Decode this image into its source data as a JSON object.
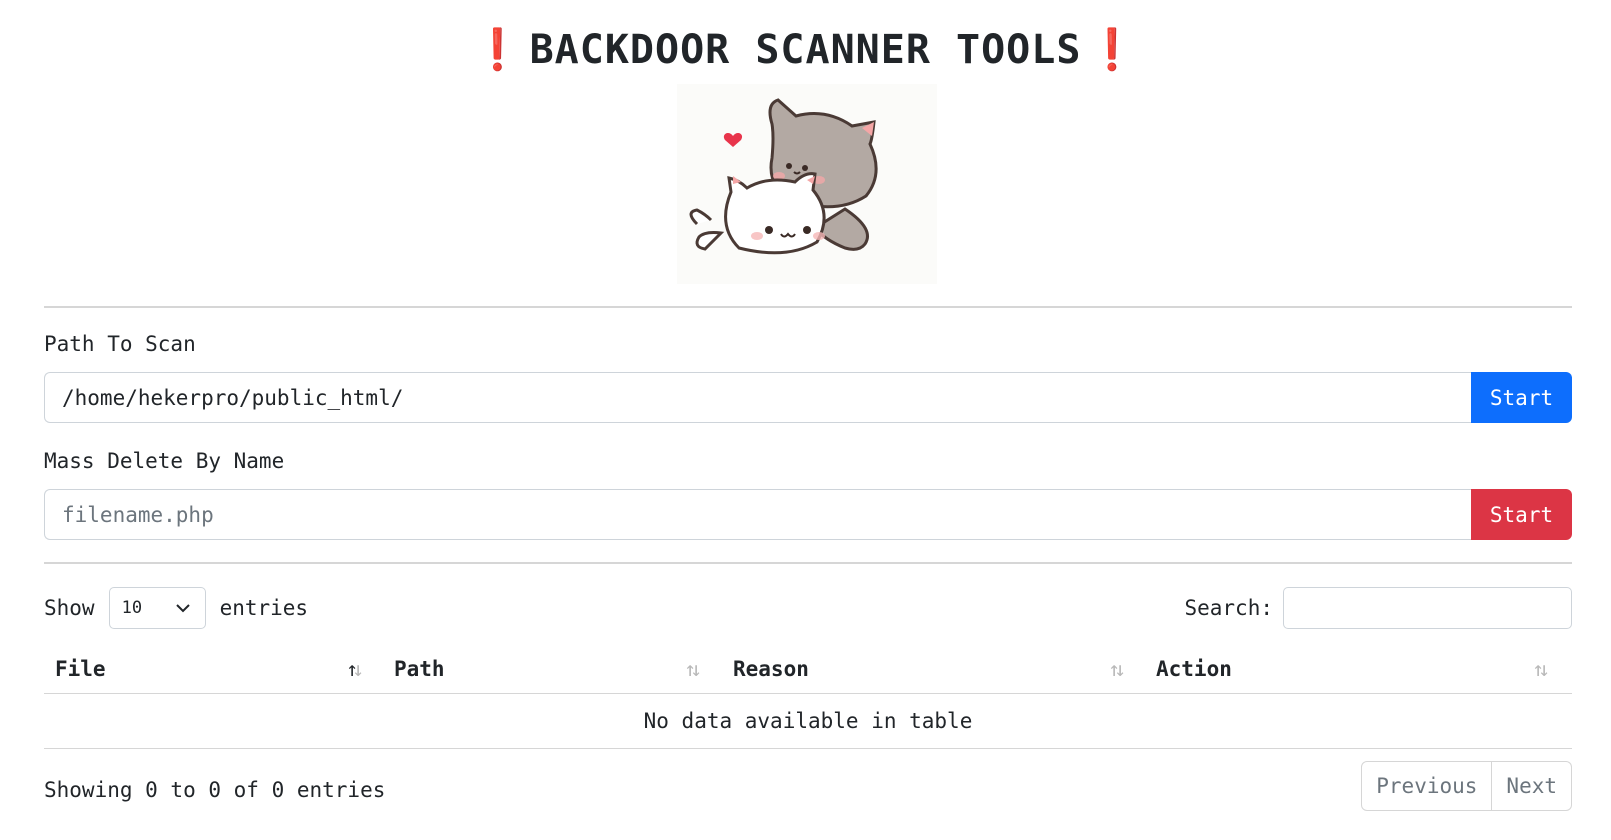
{
  "header": {
    "title": "BACKDOOR SCANNER TOOLS",
    "bang_left": "❗",
    "bang_right": "❗"
  },
  "scan": {
    "label": "Path To Scan",
    "value": "/home/hekerpro/public_html/",
    "button": "Start"
  },
  "mass_delete": {
    "label": "Mass Delete By Name",
    "placeholder": "filename.php",
    "button": "Start"
  },
  "table_controls": {
    "show_label": "Show",
    "entries_value": "10",
    "entries_label": "entries",
    "search_label": "Search:"
  },
  "table": {
    "columns": [
      "File",
      "Path",
      "Reason",
      "Action"
    ],
    "empty_message": "No data available in table"
  },
  "footer": {
    "info": "Showing 0 to 0 of 0 entries",
    "previous": "Previous",
    "next": "Next"
  },
  "colors": {
    "primary": "#0d6efd",
    "danger": "#dc3545",
    "bang": "#e8254b"
  }
}
